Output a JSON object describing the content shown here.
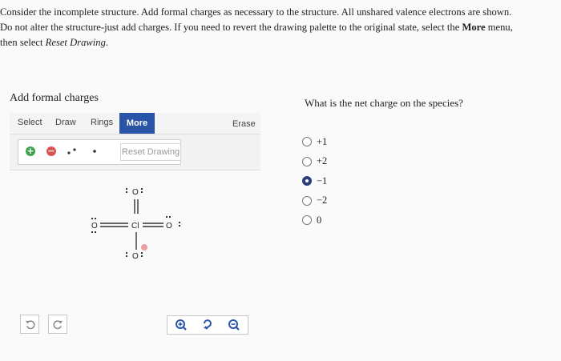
{
  "prompt": {
    "line1": "Consider the incomplete structure. Add formal charges as necessary to the structure. All unshared valence electrons are shown.",
    "line2_pre": "Do not alter the structure-just add charges. If you need to revert the drawing palette to the original state, select the ",
    "line2_bold": "More",
    "line2_post": " menu,",
    "line3_pre": "then select ",
    "line3_italic": "Reset Drawing",
    "line3_post": "."
  },
  "panel": {
    "title": "Add formal charges"
  },
  "toolbar": {
    "select": "Select",
    "draw": "Draw",
    "rings": "Rings",
    "more": "More",
    "erase": "Erase"
  },
  "palette": {
    "plus": "+",
    "minus": "−",
    "reset": "Reset Drawing"
  },
  "molecule": {
    "center": "Cl",
    "top": "O",
    "left": "O",
    "right": "O",
    "bottom": "O"
  },
  "question": {
    "text": "What is the net charge on the species?",
    "options": [
      "+1",
      "+2",
      "−1",
      "−2",
      "0"
    ],
    "selected_index": 2
  },
  "colors": {
    "accent": "#2a54a8",
    "plus_green": "#3fa34d",
    "minus_red": "#d9534f"
  }
}
